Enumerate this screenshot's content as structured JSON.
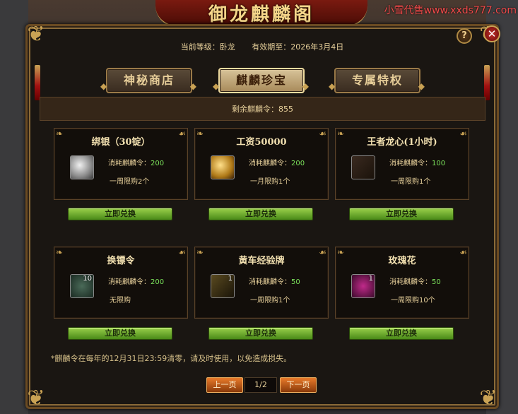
{
  "header": {
    "banner_title": "御龙麒麟阁",
    "watermark": "小雪代售www.xxds777.com"
  },
  "info": {
    "level_label": "当前等级：卧龙",
    "expiry_label": "有效期至：2026年3月4日"
  },
  "tabs": [
    {
      "label": "神秘商店",
      "active": false
    },
    {
      "label": "麒麟珍宝",
      "active": true
    },
    {
      "label": "专属特权",
      "active": false
    }
  ],
  "remaining": "剩余麒麟令：855",
  "cost_prefix": "消耗麒麟令：",
  "items": [
    {
      "title": "绑银（30锭）",
      "icon": "silver-ingot-icon",
      "count": "",
      "cost": "200",
      "limit": "一周限购2个",
      "button": "立即兑换"
    },
    {
      "title": "工资50000",
      "icon": "gold-coin-icon",
      "count": "",
      "cost": "200",
      "limit": "一月限购1个",
      "button": "立即兑换"
    },
    {
      "title": "王者龙心(1小时)",
      "icon": "dragon-heart-icon",
      "count": "",
      "cost": "100",
      "limit": "一周限购1个",
      "button": "立即兑换"
    },
    {
      "title": "换镖令",
      "icon": "escort-token-icon",
      "count": "10",
      "cost": "200",
      "limit": "无限购",
      "button": "立即兑换"
    },
    {
      "title": "黄车经验牌",
      "icon": "yellow-cart-icon",
      "count": "1",
      "cost": "50",
      "limit": "一周限购1个",
      "button": "立即兑换"
    },
    {
      "title": "玫瑰花",
      "icon": "rose-icon",
      "count": "1",
      "cost": "50",
      "limit": "一周限购10个",
      "button": "立即兑换"
    }
  ],
  "footnote": "*麒麟令在每年的12月31日23:59清零，请及时使用，以免造成损失。",
  "pager": {
    "prev": "上一页",
    "page": "1/2",
    "next": "下一页"
  },
  "buttons": {
    "help": "?",
    "close": "✕"
  }
}
